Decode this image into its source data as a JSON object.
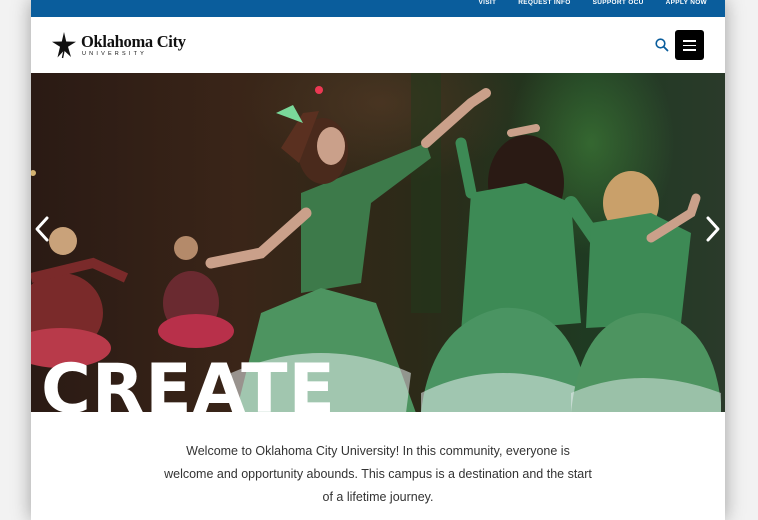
{
  "utility_nav": {
    "links": [
      "VISIT",
      "REQUEST INFO",
      "SUPPORT OCU",
      "APPLY NOW"
    ]
  },
  "header": {
    "logo_name": "Oklahoma City",
    "logo_sub": "UNIVERSITY",
    "search_icon": "search-icon",
    "menu_icon": "hamburger-menu-icon"
  },
  "hero": {
    "headline": "CREATE",
    "prev_icon": "chevron-left-icon",
    "next_icon": "chevron-right-icon"
  },
  "intro": {
    "text": "Welcome to Oklahoma City University! In this community, everyone is welcome and opportunity abounds. This campus is a destination and the start of a lifetime journey."
  },
  "colors": {
    "utility_bar": "#0a5d9c",
    "menu_button": "#000000",
    "search_icon": "#0a5d9c",
    "body_text": "#333333"
  }
}
